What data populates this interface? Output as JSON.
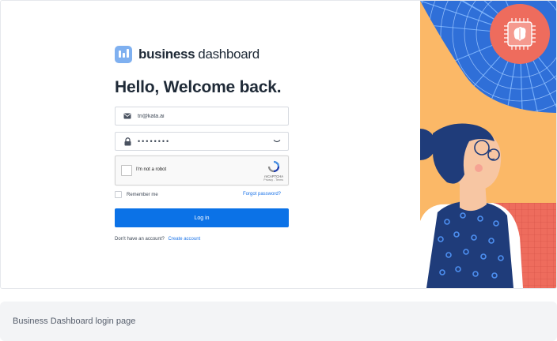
{
  "brand": {
    "name_bold": "business",
    "name_light": "dashboard"
  },
  "login": {
    "heading": "Hello, Welcome back.",
    "email_value": "tri@kata.ai",
    "password_value": "••••••••",
    "captcha": {
      "label": "I'm not a robot",
      "brand": "reCAPTCHA",
      "links": "Privacy - Terms"
    },
    "remember_label": "Remember me",
    "forgot_label": "Forgot password?",
    "login_button": "Log in",
    "signup_prompt": "Don't have an account?",
    "signup_link": "Create account"
  },
  "caption": "Business Dashboard login page",
  "colors": {
    "primary": "#0b72e7",
    "link": "#1a73e8",
    "illustration_orange": "#fbb867",
    "illustration_blue": "#2f6fd8",
    "illustration_coral": "#ee6c5d",
    "illustration_navy": "#1f3c7a"
  },
  "icons": {
    "logo": "bar-chart-logo",
    "email": "mail-icon",
    "password": "lock-icon",
    "reveal": "eye-closed-icon",
    "badge": "brain-chip-icon"
  }
}
